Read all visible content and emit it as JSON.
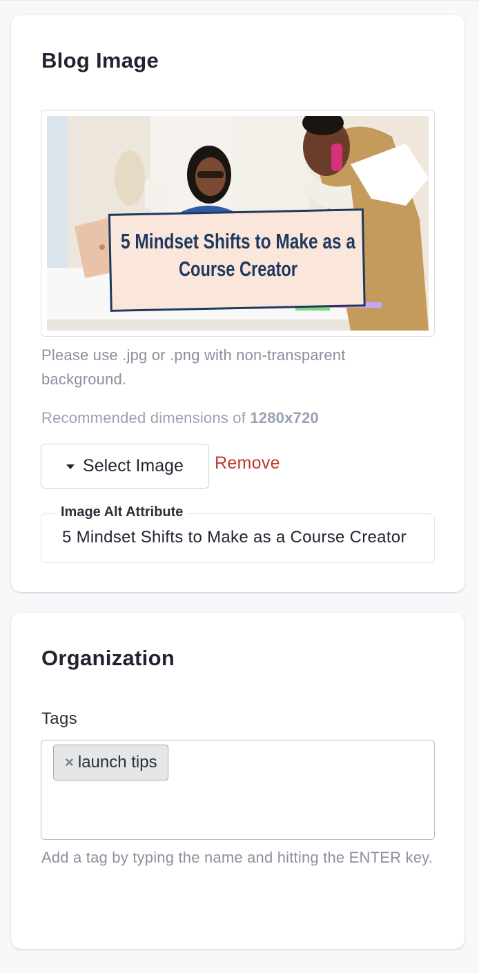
{
  "blog_image": {
    "title": "Blog Image",
    "thumbnail": {
      "headline_line1": "5 Mindset Shifts to Make as a",
      "headline_line2": "Course Creator"
    },
    "format_help": "Please use .jpg or .png with non-transparent background.",
    "dimensions_prefix": "Recommended dimensions of ",
    "dimensions_value": "1280x720",
    "select_button_label": "Select Image",
    "remove_label": "Remove",
    "alt_attribute": {
      "label": "Image Alt Attribute",
      "value": "5 Mindset Shifts to Make as a Course Creator"
    }
  },
  "organization": {
    "title": "Organization",
    "tags_label": "Tags",
    "tags": [
      {
        "label": "launch tips",
        "remove_glyph": "×"
      }
    ],
    "tags_help": "Add a tag by typing the name and hitting the ENTER key."
  },
  "colors": {
    "remove_red": "#c0392b",
    "helper_text": "#8a909c",
    "thumbnail_banner_bg": "#fbe6dc",
    "thumbnail_banner_text": "#1f3a5f"
  },
  "icons": {
    "select_caret": "caret-down-icon",
    "tag_remove": "close-icon"
  }
}
